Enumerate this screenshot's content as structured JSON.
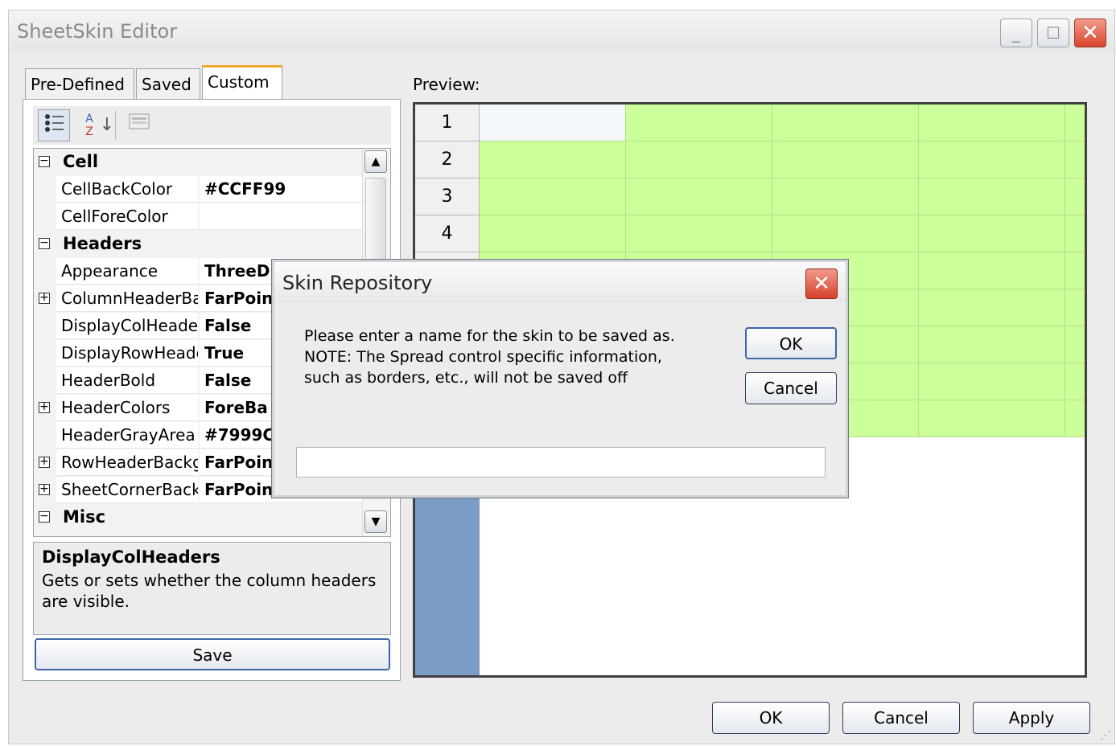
{
  "window": {
    "title": "SheetSkin Editor",
    "minimize": "_",
    "maximize": "☐",
    "close": "✕"
  },
  "tabs": [
    {
      "label": "Pre-Defined"
    },
    {
      "label": "Saved"
    },
    {
      "label": "Custom"
    }
  ],
  "toolbar": {
    "categorized_icon": "categorized-icon",
    "alpha_icon": "A↓Z",
    "alpha_top": "A",
    "alpha_bottom": "Z",
    "pages_icon": "property-pages-icon"
  },
  "property_grid": {
    "categories": [
      {
        "label": "Cell",
        "expander": "⊟"
      },
      {
        "label": "Headers",
        "expander": "⊟"
      },
      {
        "label": "Misc",
        "expander": "⊟"
      }
    ],
    "properties": [
      {
        "name": "CellBackColor",
        "value": "#CCFF99",
        "expander": ""
      },
      {
        "name": "CellForeColor",
        "value": "",
        "expander": ""
      },
      {
        "name": "Appearance",
        "value": "ThreeD",
        "expander": ""
      },
      {
        "name": "ColumnHeaderBa",
        "value": "FarPoint",
        "expander": "+"
      },
      {
        "name": "DisplayColHeader",
        "value": "False",
        "expander": ""
      },
      {
        "name": "DisplayRowHeade",
        "value": "True",
        "expander": ""
      },
      {
        "name": "HeaderBold",
        "value": "False",
        "expander": ""
      },
      {
        "name": "HeaderColors",
        "value": "ForeBa",
        "expander": "+"
      },
      {
        "name": "HeaderGrayArea",
        "value": "#7999C",
        "expander": ""
      },
      {
        "name": "RowHeaderBackg",
        "value": "FarPoint",
        "expander": "+"
      },
      {
        "name": "SheetCornerBack",
        "value": "FarPoint",
        "expander": "+"
      }
    ],
    "scroll_up": "▲",
    "scroll_down": "▼"
  },
  "description": {
    "title": "DisplayColHeaders",
    "text": "Gets or sets whether the column headers are visible."
  },
  "save_button": "Save",
  "preview": {
    "label": "Preview:",
    "row_headers": [
      "1",
      "2",
      "3",
      "4"
    ],
    "cell_color": "#CCFF99",
    "header_gray_color": "#7999C6"
  },
  "dialog": {
    "title": "Skin Repository",
    "close": "✕",
    "message_line1": "Please enter a name for the skin to be saved as.",
    "message_line2": "NOTE: The Spread control specific information,",
    "message_line3": "such as borders, etc., will not be saved off",
    "ok": "OK",
    "cancel": "Cancel",
    "name_value": ""
  },
  "footer": {
    "ok": "OK",
    "cancel": "Cancel",
    "apply": "Apply"
  }
}
